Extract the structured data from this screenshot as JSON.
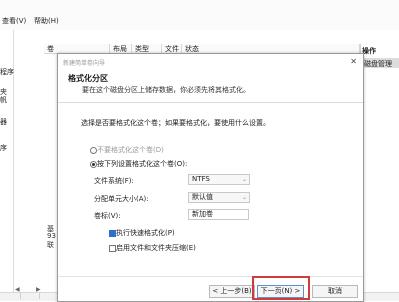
{
  "menu": {
    "view": "查看(V)",
    "help": "帮助(H)"
  },
  "tree": [
    "程序",
    "夹",
    "帆",
    "器",
    "序"
  ],
  "columns": {
    "volume": "卷",
    "layout": "布局",
    "type": "类型",
    "filesystem": "文件系统",
    "status": "状态"
  },
  "actions": {
    "header": "操作",
    "item": "磁盘管理"
  },
  "disk": {
    "a": "基",
    "b": "93",
    "c": "联"
  },
  "dialog": {
    "title": "新建简单卷向导",
    "step_title": "格式化分区",
    "step_desc": "要在这个磁盘分区上储存数据，你必须先将其格式化。",
    "prompt": "选择是否要格式化这个卷；如果要格式化，要使用什么设置。",
    "radio_no_format": "不要格式化这个卷(D)",
    "radio_format": "按下列设置格式化这个卷(O):",
    "fs_label": "文件系统(F):",
    "fs_value": "NTFS",
    "alloc_label": "分配单元大小(A):",
    "alloc_value": "默认值",
    "vol_label": "卷标(V):",
    "vol_value": "新加卷",
    "quick_format": "执行快速格式化(P)",
    "compression": "启用文件和文件夹压缩(E)",
    "back": "< 上一步(B)",
    "next": "下一页(N) >",
    "cancel": "取消"
  },
  "colors": {
    "accent": "#2d6fd0",
    "highlight": "#d23b3b"
  }
}
